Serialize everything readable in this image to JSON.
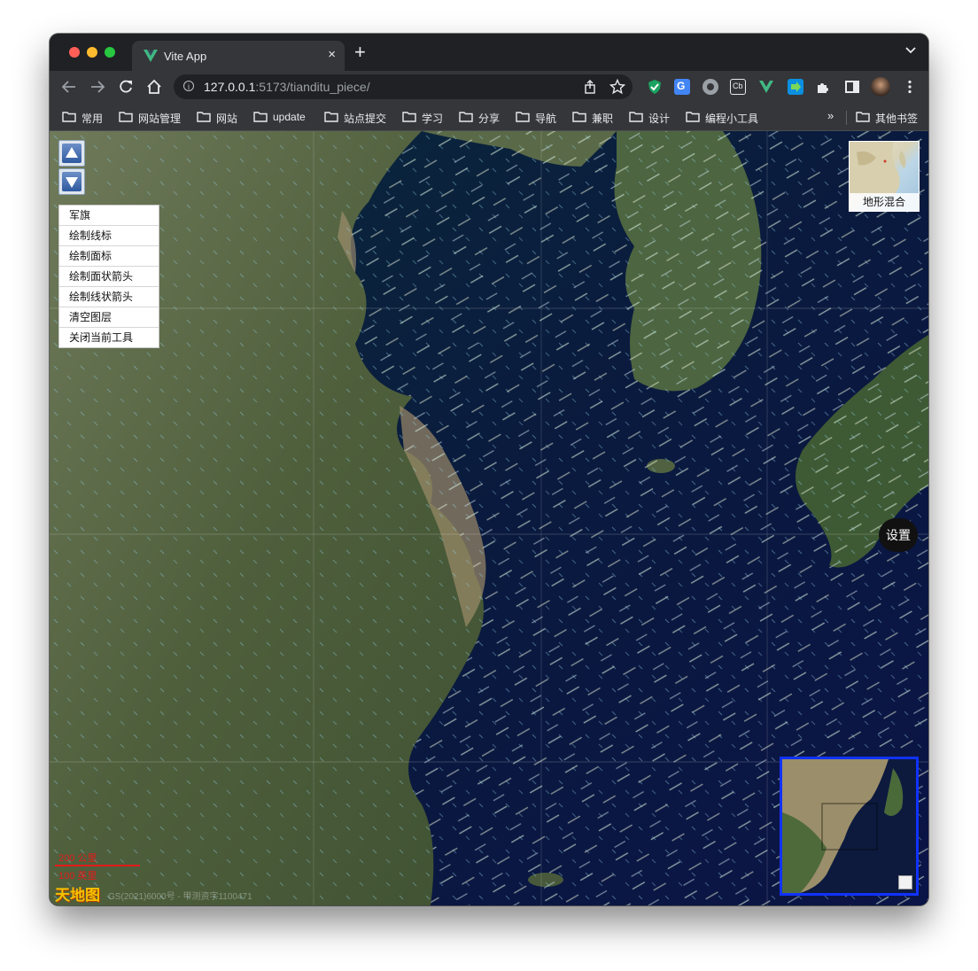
{
  "browser": {
    "tab_title": "Vite App",
    "tab_close": "×",
    "new_tab": "+",
    "url_host": "127.0.0.1",
    "url_path": ":5173/tianditu_piece/",
    "colors": {
      "frame": "#202124",
      "toolbar": "#35363a",
      "vue_green": "#41b883"
    }
  },
  "bookmarks": [
    {
      "label": "常用"
    },
    {
      "label": "网站管理"
    },
    {
      "label": "网站"
    },
    {
      "label": "update"
    },
    {
      "label": "站点提交"
    },
    {
      "label": "学习"
    },
    {
      "label": "分享"
    },
    {
      "label": "导航"
    },
    {
      "label": "兼职"
    },
    {
      "label": "设计"
    },
    {
      "label": "编程小工具"
    }
  ],
  "bookmarks_more": "»",
  "other_bookmarks": "其他书签",
  "map": {
    "tools_menu": [
      "军旗",
      "绘制线标",
      "绘制面标",
      "绘制面状箭头",
      "绘制线状箭头",
      "清空图层",
      "关闭当前工具"
    ],
    "map_type_label": "地形混合",
    "settings_label": "设置",
    "scale_top": "200 公里",
    "scale_bottom": "100 英里",
    "logo_text": "天地图",
    "copyright": "GS(2021)6000号 - 甲测资字1100471",
    "icons": [
      "zoom-in-arrow-up-icon",
      "zoom-out-arrow-down-icon"
    ]
  }
}
